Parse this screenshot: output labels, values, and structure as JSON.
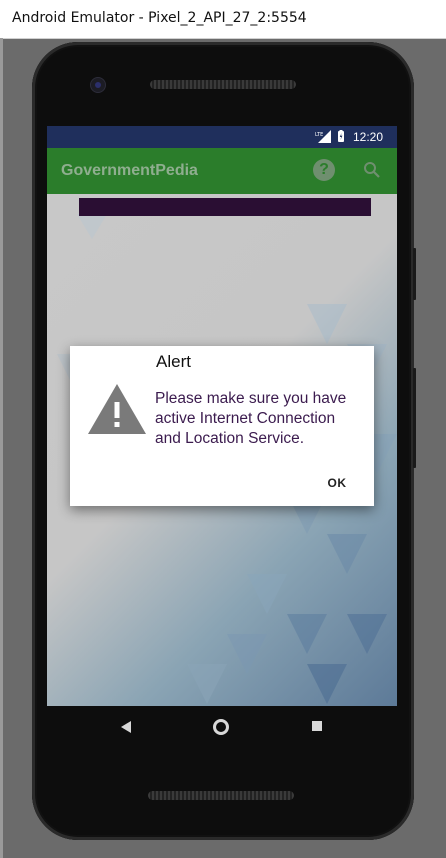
{
  "window": {
    "title": "Android Emulator - Pixel_2_API_27_2:5554"
  },
  "statusbar": {
    "network": "LTE",
    "time": "12:20"
  },
  "appbar": {
    "title": "GovernmentPedia",
    "help_icon": "?"
  },
  "dialog": {
    "title": "Alert",
    "message": "Please make sure you have\nactive Internet Connection\n and Location Service.",
    "ok_label": "OK"
  },
  "colors": {
    "appbar": "#2b7d2b",
    "statusbar": "#1f2f5c",
    "banner": "#2a0e33",
    "dialog_text": "#3b1b4e"
  }
}
